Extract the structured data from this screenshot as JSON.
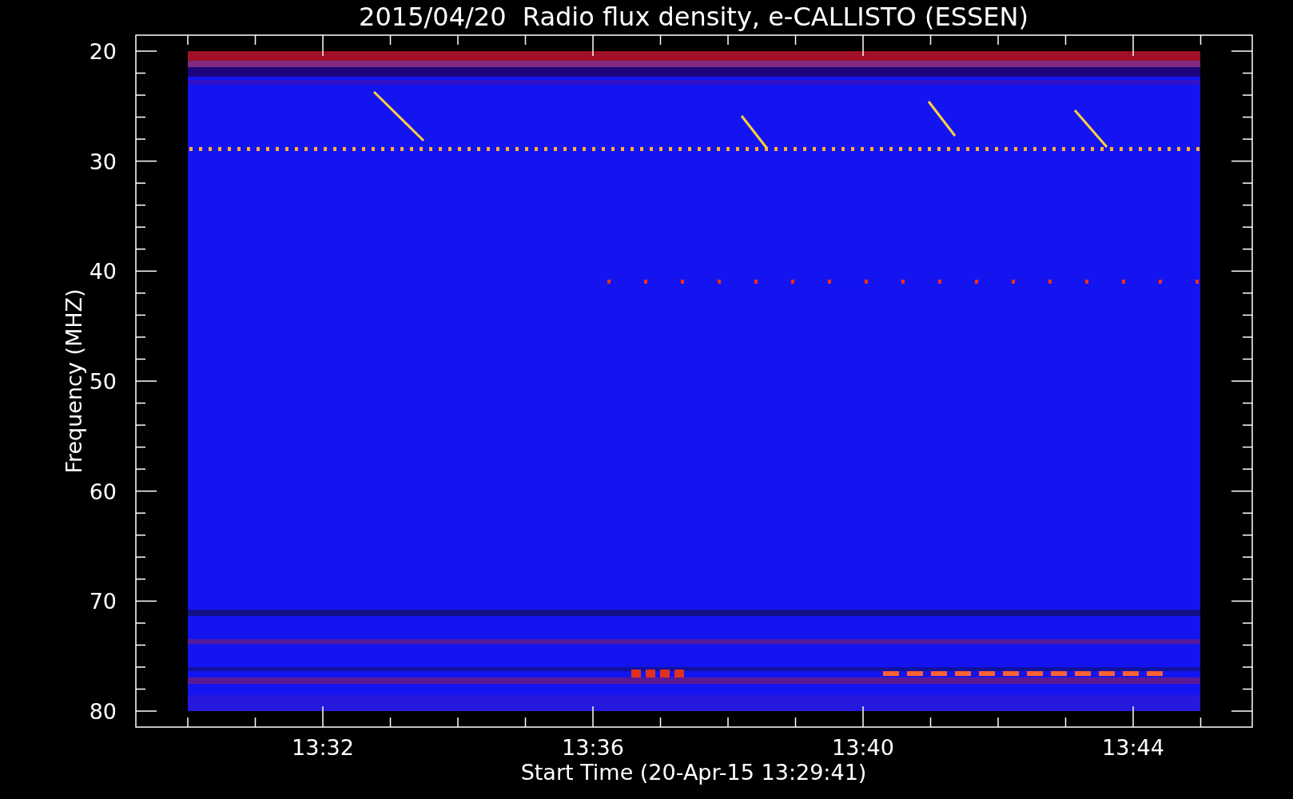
{
  "title": "2015/04/20  Radio flux density, e-CALLISTO (ESSEN)",
  "ylabel": "Frequency (MHZ)",
  "xlabel": "Start Time (20-Apr-15 13:29:41)",
  "yticks": [
    "20",
    "30",
    "40",
    "50",
    "60",
    "70",
    "80"
  ],
  "xticks": [
    "13:32",
    "13:36",
    "13:40",
    "13:44"
  ]
}
